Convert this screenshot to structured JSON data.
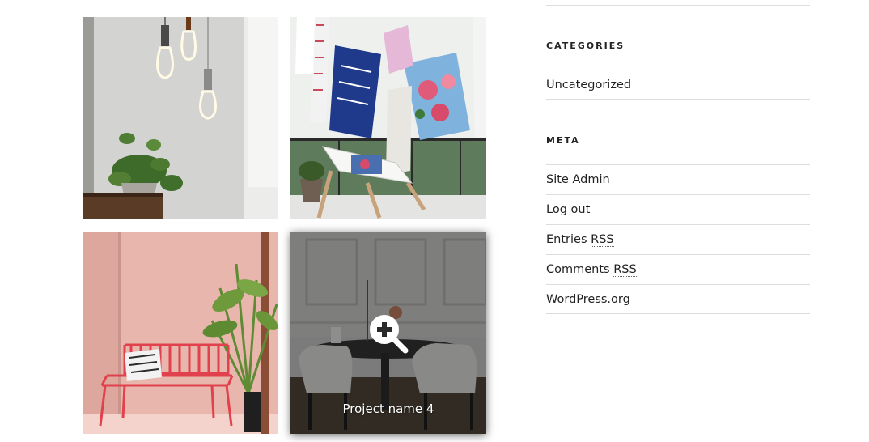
{
  "gallery": {
    "tiles": [
      {
        "image": "pendant-bulbs-with-plant"
      },
      {
        "image": "hanging-tea-towels-and-deck-chair"
      },
      {
        "image": "pink-room-red-bench-and-palm"
      },
      {
        "image": "dining-table-and-chairs",
        "caption": "Project name 4",
        "overlay_icon": "zoom-in-icon"
      }
    ]
  },
  "sidebar": {
    "categories": {
      "title": "CATEGORIES",
      "items": [
        "Uncategorized"
      ]
    },
    "meta": {
      "title": "META",
      "items": {
        "site_admin": "Site Admin",
        "log_out": "Log out",
        "entries_prefix": "Entries ",
        "entries_abbr": "RSS",
        "comments_prefix": "Comments ",
        "comments_abbr": "RSS",
        "wordpress": "WordPress.org"
      }
    }
  },
  "colors": {
    "rule": "#dddddd",
    "text": "#222222",
    "overlay": "rgba(20,20,20,0.45)"
  }
}
